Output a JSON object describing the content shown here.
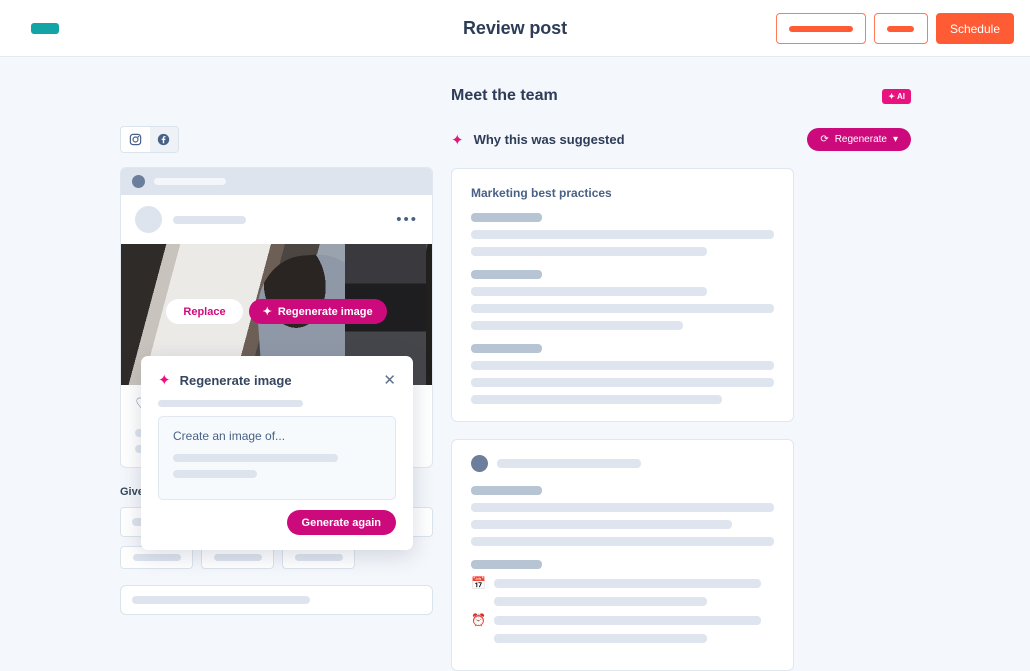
{
  "header": {
    "title": "Review post",
    "brand_color": "#13a5a5",
    "accent_color": "#ff5c35",
    "buttons": {
      "secondary_wide_label": "",
      "secondary_narrow_label": "",
      "primary_label": "Schedule"
    }
  },
  "left_panel": {
    "channels": [
      {
        "name": "instagram",
        "glyph": "◎",
        "active": true
      },
      {
        "name": "facebook",
        "glyph": "f",
        "active": false
      }
    ],
    "post_preview": {
      "kebab_glyph": "•••",
      "heart_glyph": "♡",
      "image_actions": {
        "replace_label": "Replace",
        "regenerate_label": "Regenerate image",
        "sparkle_glyph": "✦"
      }
    },
    "feedback_label": "Give feedback",
    "chips": [
      "",
      "",
      ""
    ]
  },
  "modal": {
    "title": "Regenerate image",
    "sparkle_glyph": "✦",
    "close_glyph": "✕",
    "prompt_placeholder": "Create an image of...",
    "submit_label": "Generate again",
    "accent_color": "#cc0a7b"
  },
  "right_panel": {
    "title": "Meet the team",
    "ai_badge": {
      "label": "AI",
      "sparkle_glyph": "✦",
      "color": "#e8137e"
    },
    "suggestion": {
      "sparkle_glyph": "✦",
      "text": "Why this was suggested"
    },
    "regenerate": {
      "label": "Regenerate",
      "refresh_glyph": "⟳",
      "chevron_glyph": "▾"
    },
    "card_one": {
      "heading": "Marketing best practices",
      "groups": [
        {
          "bars": [
            100,
            78
          ]
        },
        {
          "bars": [
            78,
            100,
            70
          ]
        },
        {
          "bars": [
            100,
            100,
            83
          ]
        }
      ]
    },
    "card_two": {
      "groups": [
        {
          "bars": [
            100,
            86,
            100
          ]
        }
      ],
      "icon_lines": [
        {
          "icon": "calendar-icon",
          "glyph": "📅",
          "bars": [
            88,
            76
          ]
        },
        {
          "icon": "alarm-clock-icon",
          "glyph": "⏰",
          "bars": [
            88,
            76
          ]
        }
      ]
    }
  }
}
